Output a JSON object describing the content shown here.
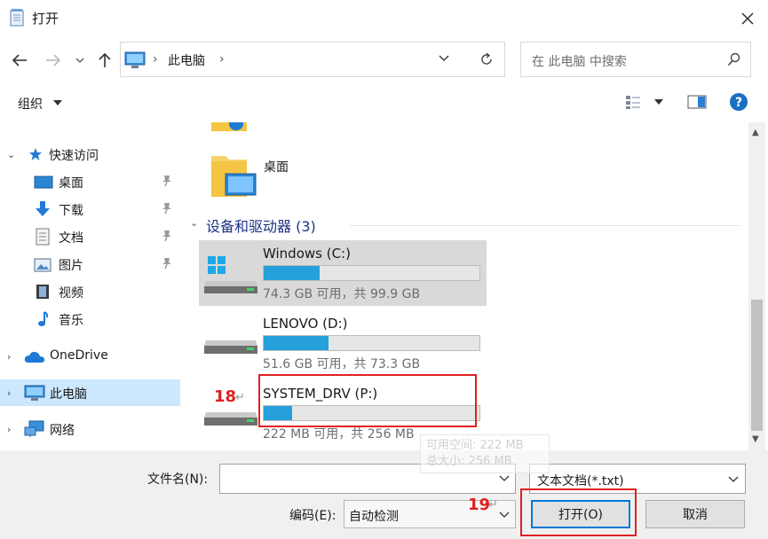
{
  "window": {
    "title": "打开"
  },
  "nav": {
    "address_root": "此电脑",
    "search_placeholder": "在 此电脑 中搜索"
  },
  "toolbar": {
    "organize_label": "组织"
  },
  "sidebar": {
    "quick_access": "快速访问",
    "desktop": "桌面",
    "downloads": "下载",
    "documents": "文档",
    "pictures": "图片",
    "videos": "视频",
    "music": "音乐",
    "onedrive": "OneDrive",
    "this_pc": "此电脑",
    "network": "网络"
  },
  "content": {
    "desktop_folder": "桌面",
    "group_header": "设备和驱动器 (3)",
    "drives": [
      {
        "name": "Windows (C:)",
        "info": "74.3 GB 可用，共 99.9 GB",
        "used_fraction": 0.26
      },
      {
        "name": "LENOVO (D:)",
        "info": "51.6 GB 可用，共 73.3 GB",
        "used_fraction": 0.3
      },
      {
        "name": "SYSTEM_DRV (P:)",
        "info": "222 MB 可用，共 256 MB",
        "used_fraction": 0.13
      }
    ],
    "tooltip_line1": "可用空间: 222 MB",
    "tooltip_line2": "总大小: 256 MB"
  },
  "annotations": {
    "n18": "18",
    "n19": "19",
    "return_mark": "↵"
  },
  "bottom": {
    "filename_label": "文件名(N):",
    "filename_value": "",
    "filter_value": "文本文档(*.txt)",
    "encoding_label": "编码(E):",
    "encoding_value": "自动检测",
    "open_button": "打开(O)",
    "cancel_button": "取消"
  },
  "colors": {
    "accent": "#26a0da",
    "selection": "#cce8ff",
    "annotation": "#e02020",
    "link_blue": "#1e3287"
  }
}
